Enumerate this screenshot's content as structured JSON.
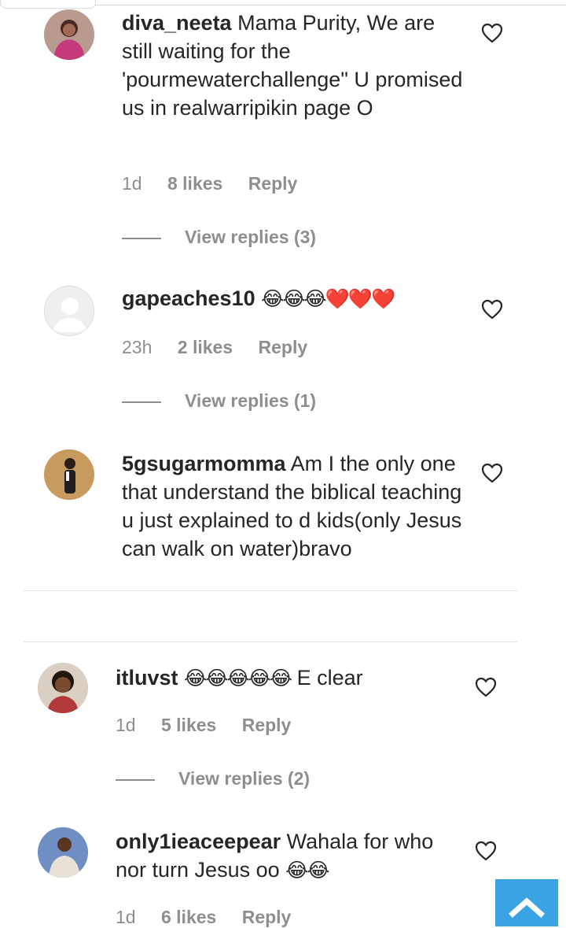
{
  "comments": [
    {
      "username": "diva_neeta",
      "text": "Mama Purity, We are still waiting for the 'pourmewaterchallenge\" U promised us in realwarripikin page O",
      "emojis": "",
      "time": "1d",
      "likes": "8 likes",
      "reply": "Reply",
      "view_replies": "View replies (3)"
    },
    {
      "username": "gapeaches10",
      "text": "",
      "emojis": "😂😂😂❤️❤️❤️",
      "time": "23h",
      "likes": "2 likes",
      "reply": "Reply",
      "view_replies": "View replies (1)"
    },
    {
      "username": "5gsugarmomma",
      "text": "Am I the only one that understand the biblical teaching u just explained to d kids(only Jesus can walk on water)bravo",
      "emojis": ""
    },
    {
      "username": "itluvst",
      "emojis": "😂😂😂😂😂",
      "text": "E clear",
      "time": "1d",
      "likes": "5 likes",
      "reply": "Reply",
      "view_replies": "View replies (2)"
    },
    {
      "username": "only1ieaceepear",
      "text": "Wahala for who nor turn Jesus oo",
      "emojis": "😂😂",
      "time": "1d",
      "likes": "6 likes",
      "reply": "Reply"
    }
  ],
  "icons": {
    "like": "heart-outline-icon",
    "scroll_top": "chevron-up-icon"
  },
  "colors": {
    "text": "#262626",
    "meta": "#8e8e8e",
    "scroll_button": "#3aa3e3"
  }
}
